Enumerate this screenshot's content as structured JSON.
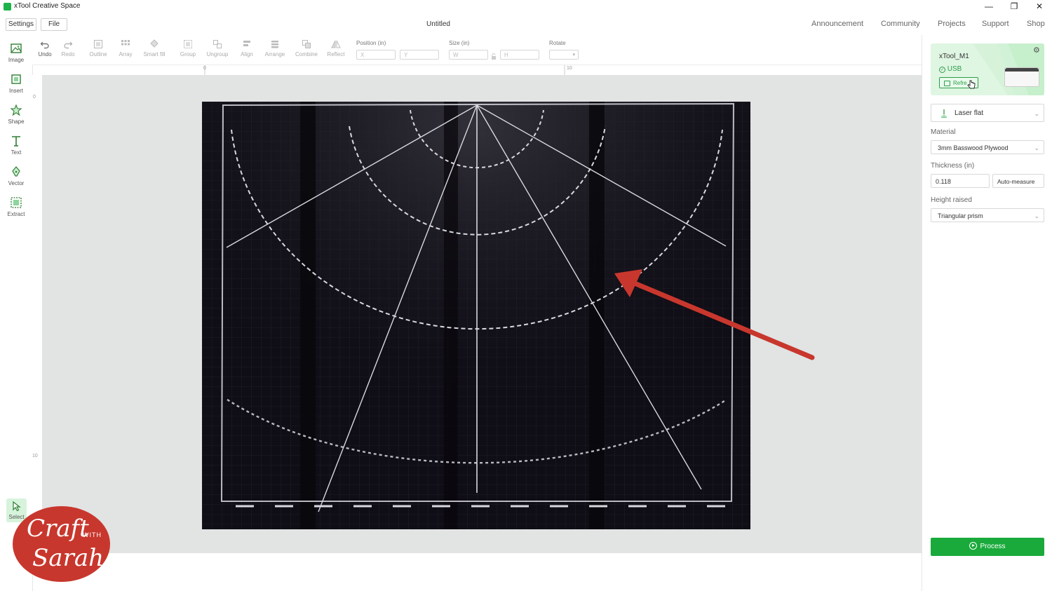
{
  "app": {
    "title": "xTool Creative Space",
    "document_title": "Untitled"
  },
  "window_controls": {
    "minimize": "—",
    "maximize": "❐",
    "close": "✕"
  },
  "menu": {
    "settings": "Settings",
    "file": "File"
  },
  "nav_links": [
    "Announcement",
    "Community",
    "Projects",
    "Support",
    "Shop"
  ],
  "left_tools": [
    {
      "label": "Image",
      "icon": "image-icon"
    },
    {
      "label": "Insert",
      "icon": "insert-icon"
    },
    {
      "label": "Shape",
      "icon": "shape-icon"
    },
    {
      "label": "Text",
      "icon": "text-icon"
    },
    {
      "label": "Vector",
      "icon": "vector-pen-icon"
    },
    {
      "label": "Extract",
      "icon": "extract-icon"
    },
    {
      "label": "Select",
      "icon": "select-cursor-icon",
      "active": true
    }
  ],
  "top_tools": {
    "undo": "Undo",
    "redo": "Redo",
    "outline": "Outline",
    "array": "Array",
    "smart_fill": "Smart fill",
    "group": "Group",
    "ungroup": "Ungroup",
    "align": "Align",
    "arrange": "Arrange",
    "combine": "Combine",
    "reflect": "Reflect"
  },
  "transform": {
    "position_label": "Position (in)",
    "x_placeholder": "X",
    "y_placeholder": "Y",
    "size_label": "Size (in)",
    "w_placeholder": "W",
    "h_placeholder": "H",
    "rotate_label": "Rotate"
  },
  "rulers": {
    "top_ticks": [
      "0",
      "10"
    ],
    "left_ticks": [
      "0",
      "10"
    ]
  },
  "device": {
    "name": "xTool_M1",
    "connection": "USB",
    "refresh_label": "Refre",
    "settings_icon": "gear-icon"
  },
  "panel": {
    "mode": "Laser flat",
    "material_label": "Material",
    "material_value": "3mm Basswood Plywood",
    "thickness_label": "Thickness (in)",
    "thickness_value": "0.118",
    "auto_measure": "Auto-measure",
    "height_raised_label": "Height raised",
    "height_raised_value": "Triangular prism",
    "process": "Process"
  },
  "watermark": {
    "line1": "Craft",
    "with": "WITH",
    "line2": "Sarah"
  },
  "colors": {
    "accent": "#1aaa3b",
    "annotation_arrow": "#c8372d",
    "canvas_bg": "#e2e3e3"
  }
}
